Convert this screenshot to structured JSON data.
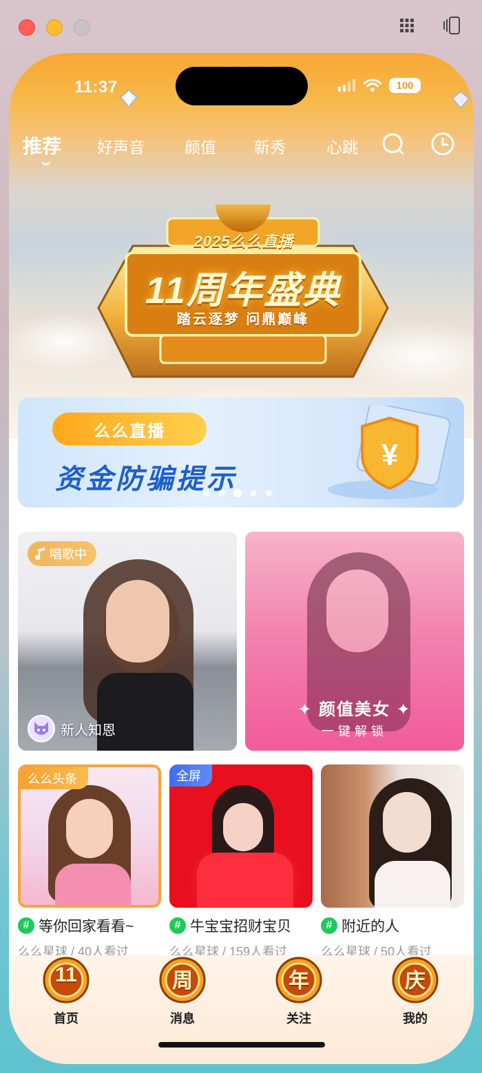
{
  "status_bar": {
    "time": "11:37",
    "battery": "100"
  },
  "top_nav": {
    "tabs": [
      "推荐",
      "好声音",
      "颜值",
      "新秀",
      "心跳"
    ],
    "active_index": 0
  },
  "hero_banner": {
    "year_line": "2025么么直播",
    "title": "11周年盛典",
    "subtitle": "踏云逐梦 问鼎巅峰"
  },
  "notice_banner": {
    "pill": "么么直播",
    "title": "资金防骗提示",
    "pager_count": 5,
    "pager_active": 2
  },
  "featured": [
    {
      "badge": "唱歌中",
      "user": "新人知恩"
    },
    {
      "title": "颜值美女",
      "subtitle": "一键解锁"
    }
  ],
  "streams": [
    {
      "tag": "么么头条",
      "title": "等你回家看看~",
      "meta": "么么星球 / 40人看过"
    },
    {
      "tag": "全屏",
      "title": "牛宝宝招财宝贝",
      "meta": "么么星球 / 159人看过"
    },
    {
      "tag": "",
      "title": "附近的人",
      "meta": "么么星球 / 50人看过"
    }
  ],
  "tab_bar": [
    {
      "medal": "11",
      "label": "首页"
    },
    {
      "medal": "周",
      "label": "消息"
    },
    {
      "medal": "年",
      "label": "关注"
    },
    {
      "medal": "庆",
      "label": "我的"
    }
  ],
  "icons": {
    "search": "search-icon",
    "history": "clock-icon",
    "hashtag": "hashtag-icon",
    "note": "music-note-icon"
  },
  "colors": {
    "accent_orange": "#f7a53a",
    "notice_blue": "#1f5fc9",
    "hashtag_green": "#1fc95b"
  }
}
